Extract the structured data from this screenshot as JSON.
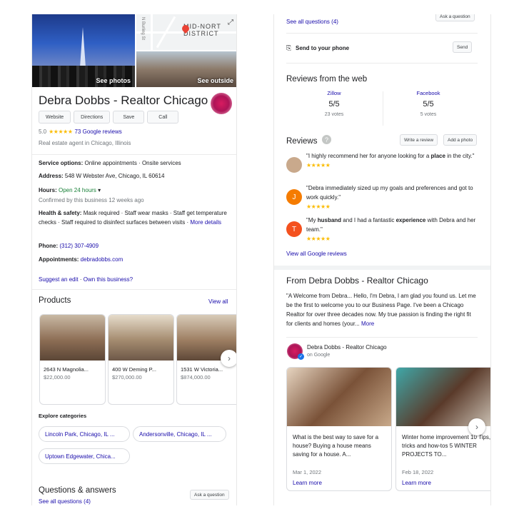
{
  "left": {
    "photos": {
      "see_photos": "See photos",
      "see_outside": "See outside",
      "map_label_1": "MID-NORT",
      "map_label_2": "DISTRICT",
      "map_street": "N Burling St"
    },
    "title": "Debra Dobbs - Realtor Chicago",
    "buttons": [
      "Website",
      "Directions",
      "Save",
      "Call"
    ],
    "rating": {
      "score": "5.0",
      "stars": "★★★★★",
      "reviews_link": "73 Google reviews"
    },
    "category": "Real estate agent in Chicago, Illinois",
    "service": {
      "label": "Service options:",
      "value": " Online appointments · Onsite services"
    },
    "address": {
      "label": "Address:",
      "value": " 548 W Webster Ave, Chicago, IL 60614"
    },
    "hours": {
      "label": "Hours:",
      "status": " Open 24 hours",
      "caret": "▾",
      "confirmed": "Confirmed by this business 12 weeks ago"
    },
    "health": {
      "label": "Health & safety:",
      "value": " Mask required · Staff wear masks · Staff get temperature checks · Staff required to disinfect surfaces between visits · ",
      "more": "More details"
    },
    "phone": {
      "label": "Phone:",
      "value": " (312) 307-4909"
    },
    "appointments": {
      "label": "Appointments:",
      "value": " debradobbs.com"
    },
    "suggest_edit": "Suggest an edit",
    "separator": " · ",
    "own_business": "Own this business?",
    "products_title": "Products",
    "view_all": "View all",
    "products": [
      {
        "name": "2643 N Magnolia...",
        "price": "$22,000.00"
      },
      {
        "name": "400 W Deming P...",
        "price": "$270,000.00"
      },
      {
        "name": "1531 W Victoria...",
        "price": "$874,000.00"
      }
    ],
    "next_arrow": "›",
    "explore_title": "Explore categories",
    "categories": [
      "Lincoln Park, Chicago, IL ...",
      "Andersonville, Chicago, IL ...",
      "Uptown Edgewater, Chica..."
    ],
    "qa_title": "Questions & answers",
    "ask_question": "Ask a question",
    "see_all_questions": "See all questions (4)"
  },
  "right": {
    "see_all_questions": "See all questions (4)",
    "ask_question": "Ask a question",
    "send_to_phone": "Send to your phone",
    "send": "Send",
    "web_reviews_title": "Reviews from the web",
    "web_reviews": [
      {
        "source": "Zillow",
        "score": "5/5",
        "votes": "23 votes"
      },
      {
        "source": "Facebook",
        "score": "5/5",
        "votes": "5 votes"
      }
    ],
    "reviews_title": "Reviews",
    "help_icon": "?",
    "write_review": "Write a review",
    "add_photo": "Add a photo",
    "reviews": [
      {
        "avatar": "",
        "color": "#c9a98c",
        "text_a": "\"I highly recommend her for anyone looking for a ",
        "bold_a": "place",
        "text_b": " in the city.\"",
        "bold_b": "",
        "text_c": "",
        "stars": "★★★★★"
      },
      {
        "avatar": "J",
        "color": "#f57c00",
        "text_a": "\"Debra immediately sized up my goals and preferences and got to work quickly.\"",
        "bold_a": "",
        "text_b": "",
        "bold_b": "",
        "text_c": "",
        "stars": "★★★★★"
      },
      {
        "avatar": "T",
        "color": "#f4511e",
        "text_a": "\"My ",
        "bold_a": "husband",
        "text_b": " and I had a fantastic ",
        "bold_b": "experience",
        "text_c": " with Debra and her team.\"",
        "stars": "★★★★★"
      }
    ],
    "view_all_reviews": "View all Google reviews",
    "from_title": "From Debra Dobbs - Realtor Chicago",
    "from_text": "\"A Welcome from Debra... Hello, I'm Debra, I am glad you found us. Let me be the first to welcome you to our Business Page. I've been a Chicago Realtor for over three decades now. My true passion is finding the right fit for clients and homes (your...",
    "from_more": "More",
    "owner_name": "Debra Dobbs - Realtor Chicago",
    "owner_sub": "on Google",
    "posts": [
      {
        "text": "What is the best way to save for a house? Buying a house means saving for a house. A...",
        "date": "Mar 1, 2022",
        "more": "Learn more"
      },
      {
        "text": "Winter home improvement 10 Tips, tricks and how-tos 5 WINTER PROJECTS TO...",
        "date": "Feb 18, 2022",
        "more": "Learn more"
      }
    ],
    "next_arrow": "›"
  }
}
